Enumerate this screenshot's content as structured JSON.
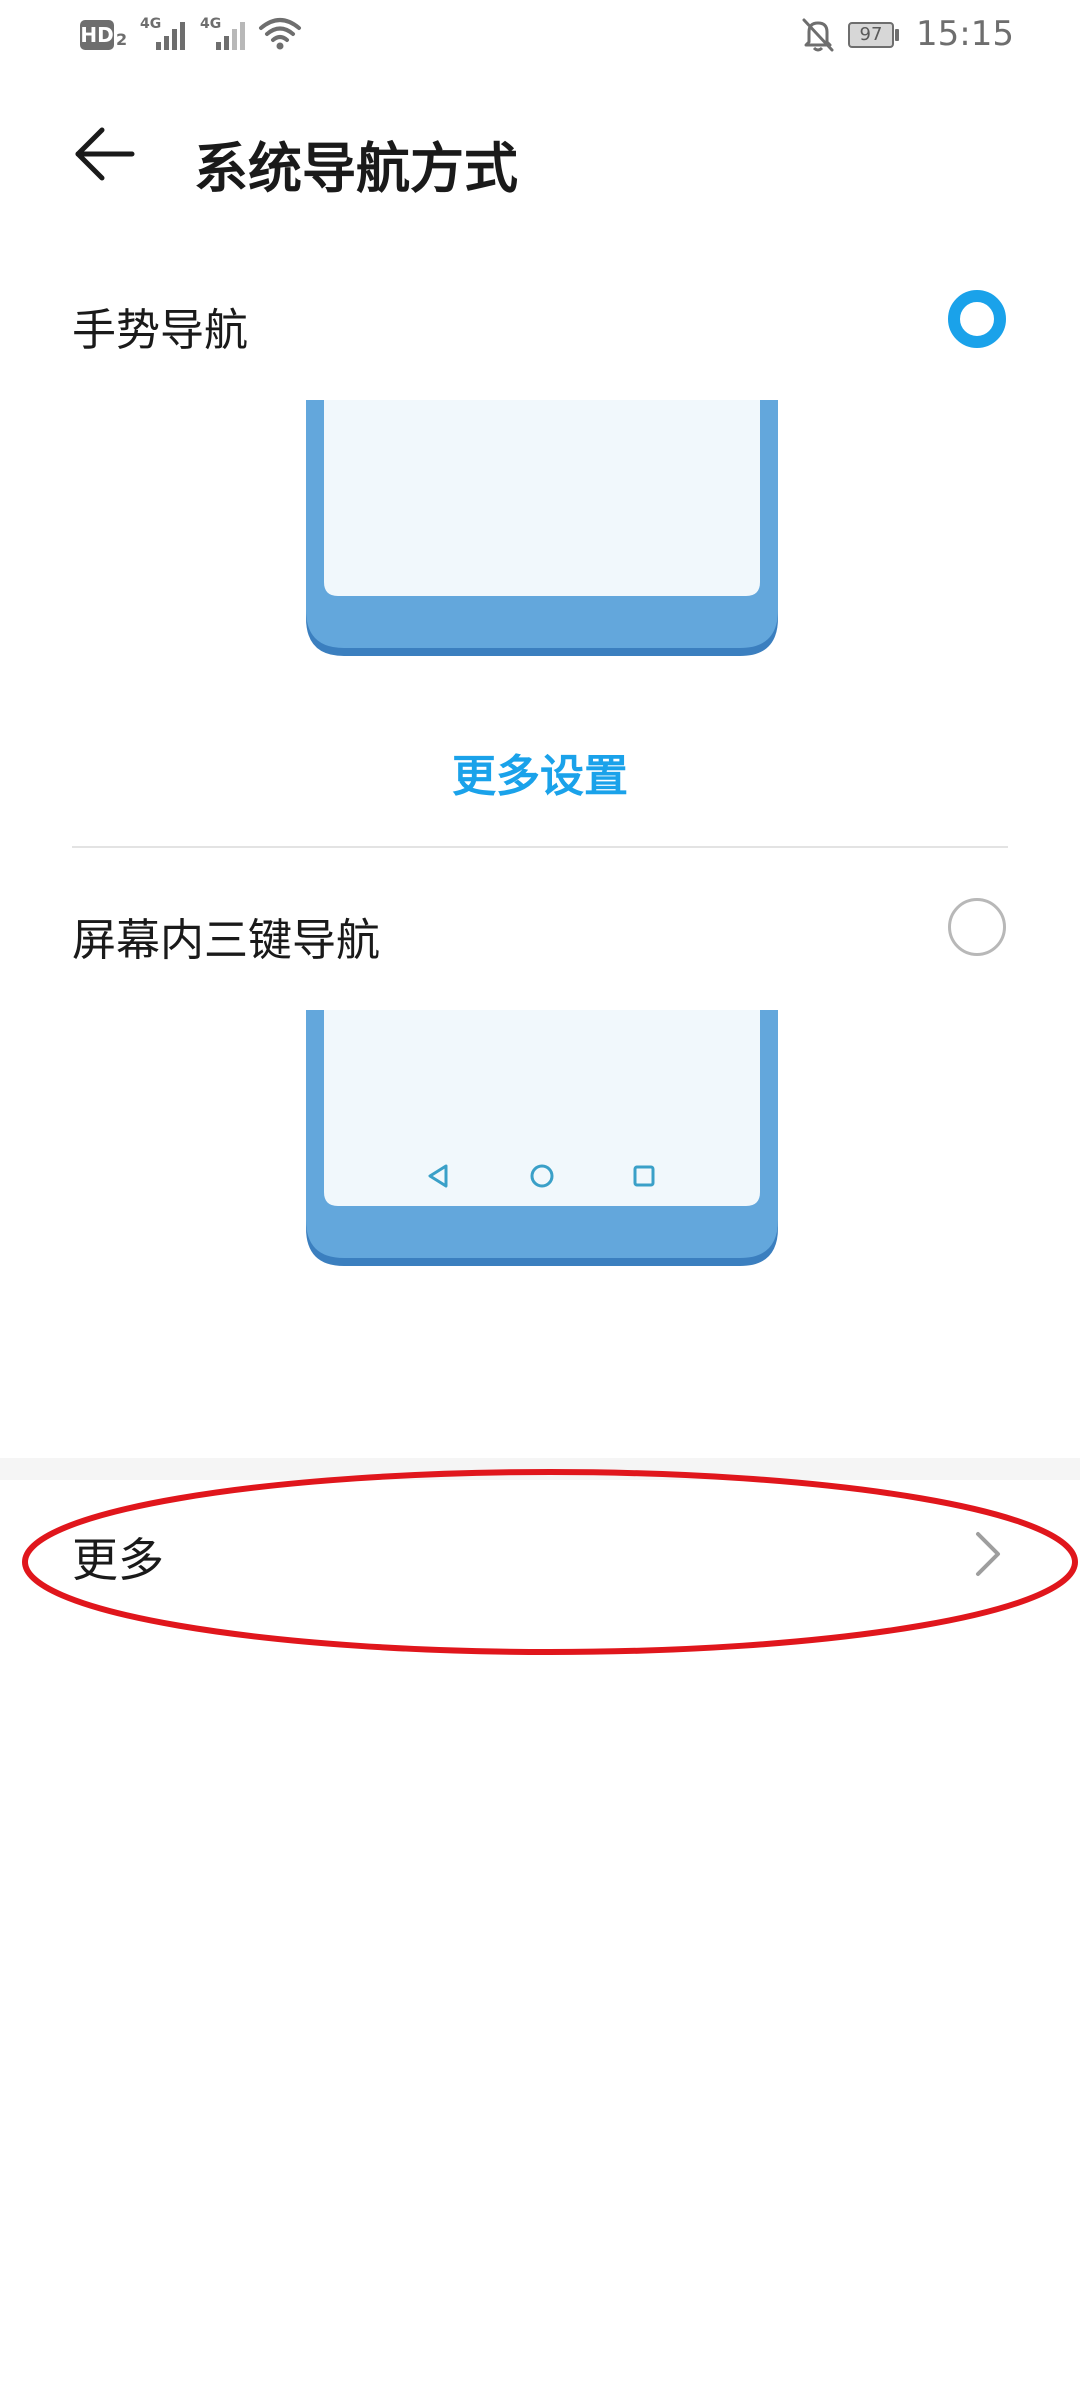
{
  "status_bar": {
    "hd_label": "HD",
    "hd_sub": "2",
    "net1": "4G",
    "net2": "4G",
    "battery": "97",
    "time": "15:15",
    "icons": [
      "signal-icon",
      "wifi-icon",
      "bell-off-icon",
      "battery-icon"
    ]
  },
  "header": {
    "title": "系统导航方式",
    "back_icon": "arrow-left-icon"
  },
  "options": [
    {
      "label": "手势导航",
      "selected": true,
      "action_label": "更多设置"
    },
    {
      "label": "屏幕内三键导航",
      "selected": false,
      "nav_icons": [
        "triangle-back-icon",
        "circle-home-icon",
        "square-recents-icon"
      ]
    }
  ],
  "more": {
    "label": "更多",
    "icon": "chevron-right-icon"
  },
  "colors": {
    "accent": "#1aa2ea",
    "phone_frame": "#63a7dc",
    "phone_frame_dark": "#3b7fbf",
    "phone_screen": "#f1f8fc",
    "highlight": "#e0161c"
  }
}
